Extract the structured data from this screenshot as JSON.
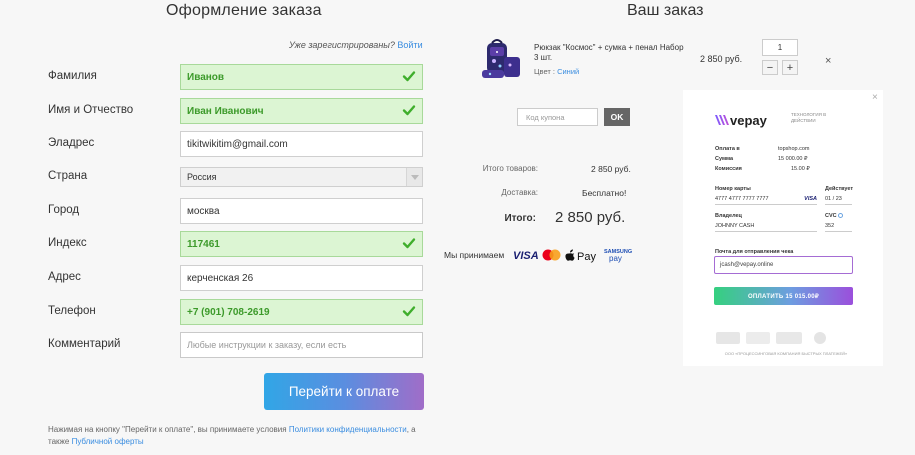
{
  "checkout": {
    "title": "Оформление заказа",
    "registered_text": "Уже зарегистрированы?",
    "login_link": "Войти",
    "fields": [
      {
        "label": "Фамилия",
        "value": "Иванов"
      },
      {
        "label": "Имя и Отчество",
        "value": "Иван Иванович"
      },
      {
        "label": "Эладрес",
        "value": "tikitwikitim@gmail.com"
      },
      {
        "label": "Страна",
        "value": "Россия"
      },
      {
        "label": "Город",
        "value": "москва"
      },
      {
        "label": "Индекс",
        "value": "117461"
      },
      {
        "label": "Адрес",
        "value": "керченская 26"
      },
      {
        "label": "Телефон",
        "value": "+7 (901) 708-2619"
      },
      {
        "label": "Комментарий",
        "placeholder": "Любые инструкции к заказу, если есть"
      }
    ],
    "pay_button": "Перейти к оплате",
    "legal_text_1": "Нажимая на кнопку \"Перейти к оплате\", вы принимаете условия",
    "legal_link_1": "Политики конфиденциальности",
    "legal_text_2": ", а также",
    "legal_link_2": "Публичной оферты"
  },
  "order": {
    "title": "Ваш заказ",
    "product_name": "Рюкзак \"Космос\" + сумка + пенал Набор 3 шт.",
    "product_color_label": "Цвет :",
    "product_color": "Синий",
    "product_price": "2 850 руб.",
    "quantity": "1",
    "minus": "−",
    "plus": "+",
    "remove": "×",
    "coupon_placeholder": "Код купона",
    "coupon_button": "OK",
    "items_label": "Итого товаров:",
    "items_value": "2 850 руб.",
    "delivery_label": "Доставка:",
    "delivery_value": "Бесплатно!",
    "total_label": "Итого:",
    "total_value": "2 850 руб.",
    "accept_text": "Мы принимаем",
    "payment_methods": [
      "VISA",
      "Mastercard",
      "Apple Pay",
      "Samsung Pay"
    ]
  },
  "vepay": {
    "close": "×",
    "brand": "vepay",
    "tagline": "ТЕХНОЛОГИЯ В ДЕЙСТВИИ",
    "pay_to_label": "Оплата в",
    "pay_to_value": "topshop.com",
    "amount_label": "Сумма",
    "amount_value": "15 000.00 ₽",
    "fee_label": "Комиссия",
    "fee_value": "15.00 ₽",
    "card_label": "Номер карты",
    "card_value": "4777 4777 7777 7777",
    "card_brand": "VISA",
    "valid_label": "Действует",
    "valid_value": "01 / 23",
    "holder_label": "Владелец",
    "holder_value": "JOHNNY CASH",
    "cvc_label": "CVC",
    "cvc_value": "352",
    "email_label": "Почта для отправления чека",
    "email_value": "jcash@vepay.online",
    "pay_button": "ОПЛАТИТЬ   15 015.00₽",
    "footer": "ООО «ПРОЦЕССИНГОВАЯ КОМПАНИЯ БЫСТРЫХ ПЛАТЕЖЕЙ»"
  },
  "colors": {
    "valid_bg": "#dcf5d3",
    "valid_text": "#3c9a2a",
    "link": "#3a8de0"
  }
}
